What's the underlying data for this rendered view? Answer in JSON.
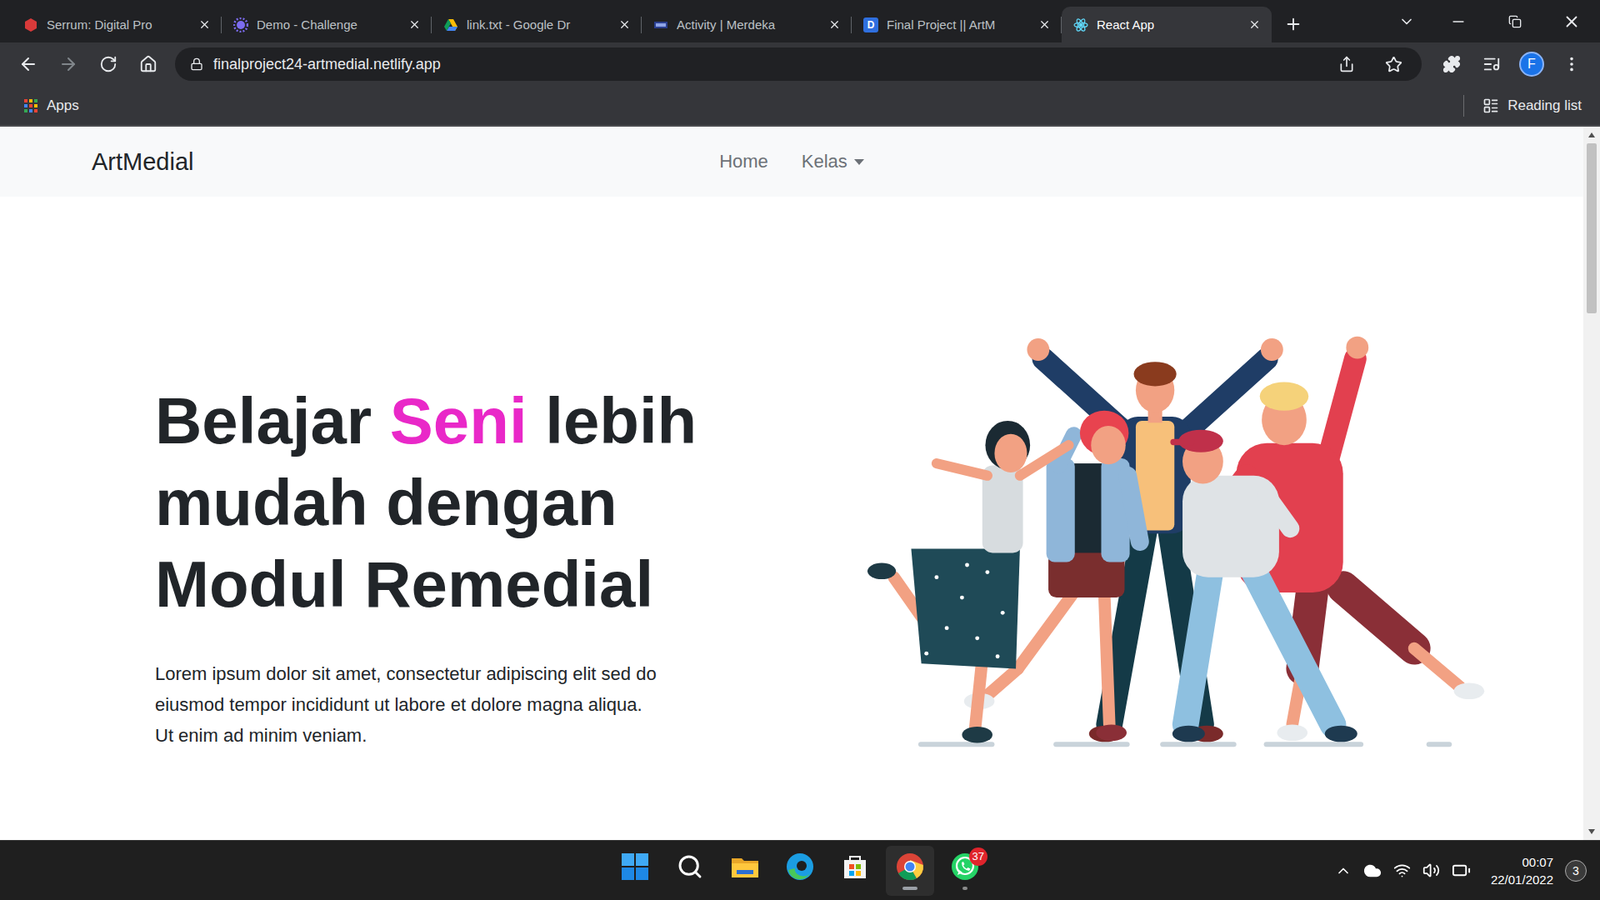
{
  "browser": {
    "tabs": [
      {
        "label": "Serrum: Digital Pro",
        "kind": "serrum",
        "selected": false
      },
      {
        "label": "Demo - Challenge",
        "kind": "demo",
        "selected": false
      },
      {
        "label": "link.txt - Google Dr",
        "kind": "drive",
        "selected": false
      },
      {
        "label": "Activity | Merdeka",
        "kind": "merdeka",
        "selected": false
      },
      {
        "label": "Final Project || ArtM",
        "kind": "docs",
        "icon_text": "D",
        "selected": false
      },
      {
        "label": "React App",
        "kind": "react",
        "selected": true
      }
    ],
    "nav": {
      "back_enabled": true,
      "forward_enabled": false
    },
    "url": "finalproject24-artmedial.netlify.app",
    "profile": "F",
    "bookmarks": [
      {
        "label": "Apps"
      }
    ],
    "reading_list": "Reading list"
  },
  "page": {
    "brand": "ArtMedial",
    "nav": [
      {
        "label": "Home",
        "kind": "link"
      },
      {
        "label": "Kelas",
        "kind": "dropdown"
      }
    ],
    "hero": {
      "title_lines": [
        [
          {
            "text": "Belajar ",
            "highlight": false
          },
          {
            "text": "Seni",
            "highlight": true
          },
          {
            "text": " lebih",
            "highlight": false
          }
        ],
        [
          {
            "text": "mudah dengan",
            "highlight": false
          }
        ],
        [
          {
            "text": "Modul Remedial",
            "highlight": false
          }
        ]
      ],
      "text": "Lorem ipsum dolor sit amet, consectetur adipiscing elit sed do eiusmod tempor incididunt ut labore et dolore magna aliqua. Ut enim ad minim veniam."
    },
    "scrollbar": {
      "position": 0,
      "thumb_share": 0.25
    }
  },
  "taskbar": {
    "apps": [
      {
        "kind": "start",
        "active": false,
        "running": false
      },
      {
        "kind": "search",
        "active": false,
        "running": false
      },
      {
        "kind": "explorer",
        "active": false,
        "running": false
      },
      {
        "kind": "edge",
        "active": false,
        "running": false
      },
      {
        "kind": "store",
        "active": false,
        "running": false
      },
      {
        "kind": "chrome",
        "active": true,
        "running": true
      },
      {
        "kind": "whatsapp",
        "active": false,
        "running": true,
        "badge": "37"
      }
    ],
    "time": "00:07",
    "date": "22/01/2022",
    "notifications": "3"
  }
}
